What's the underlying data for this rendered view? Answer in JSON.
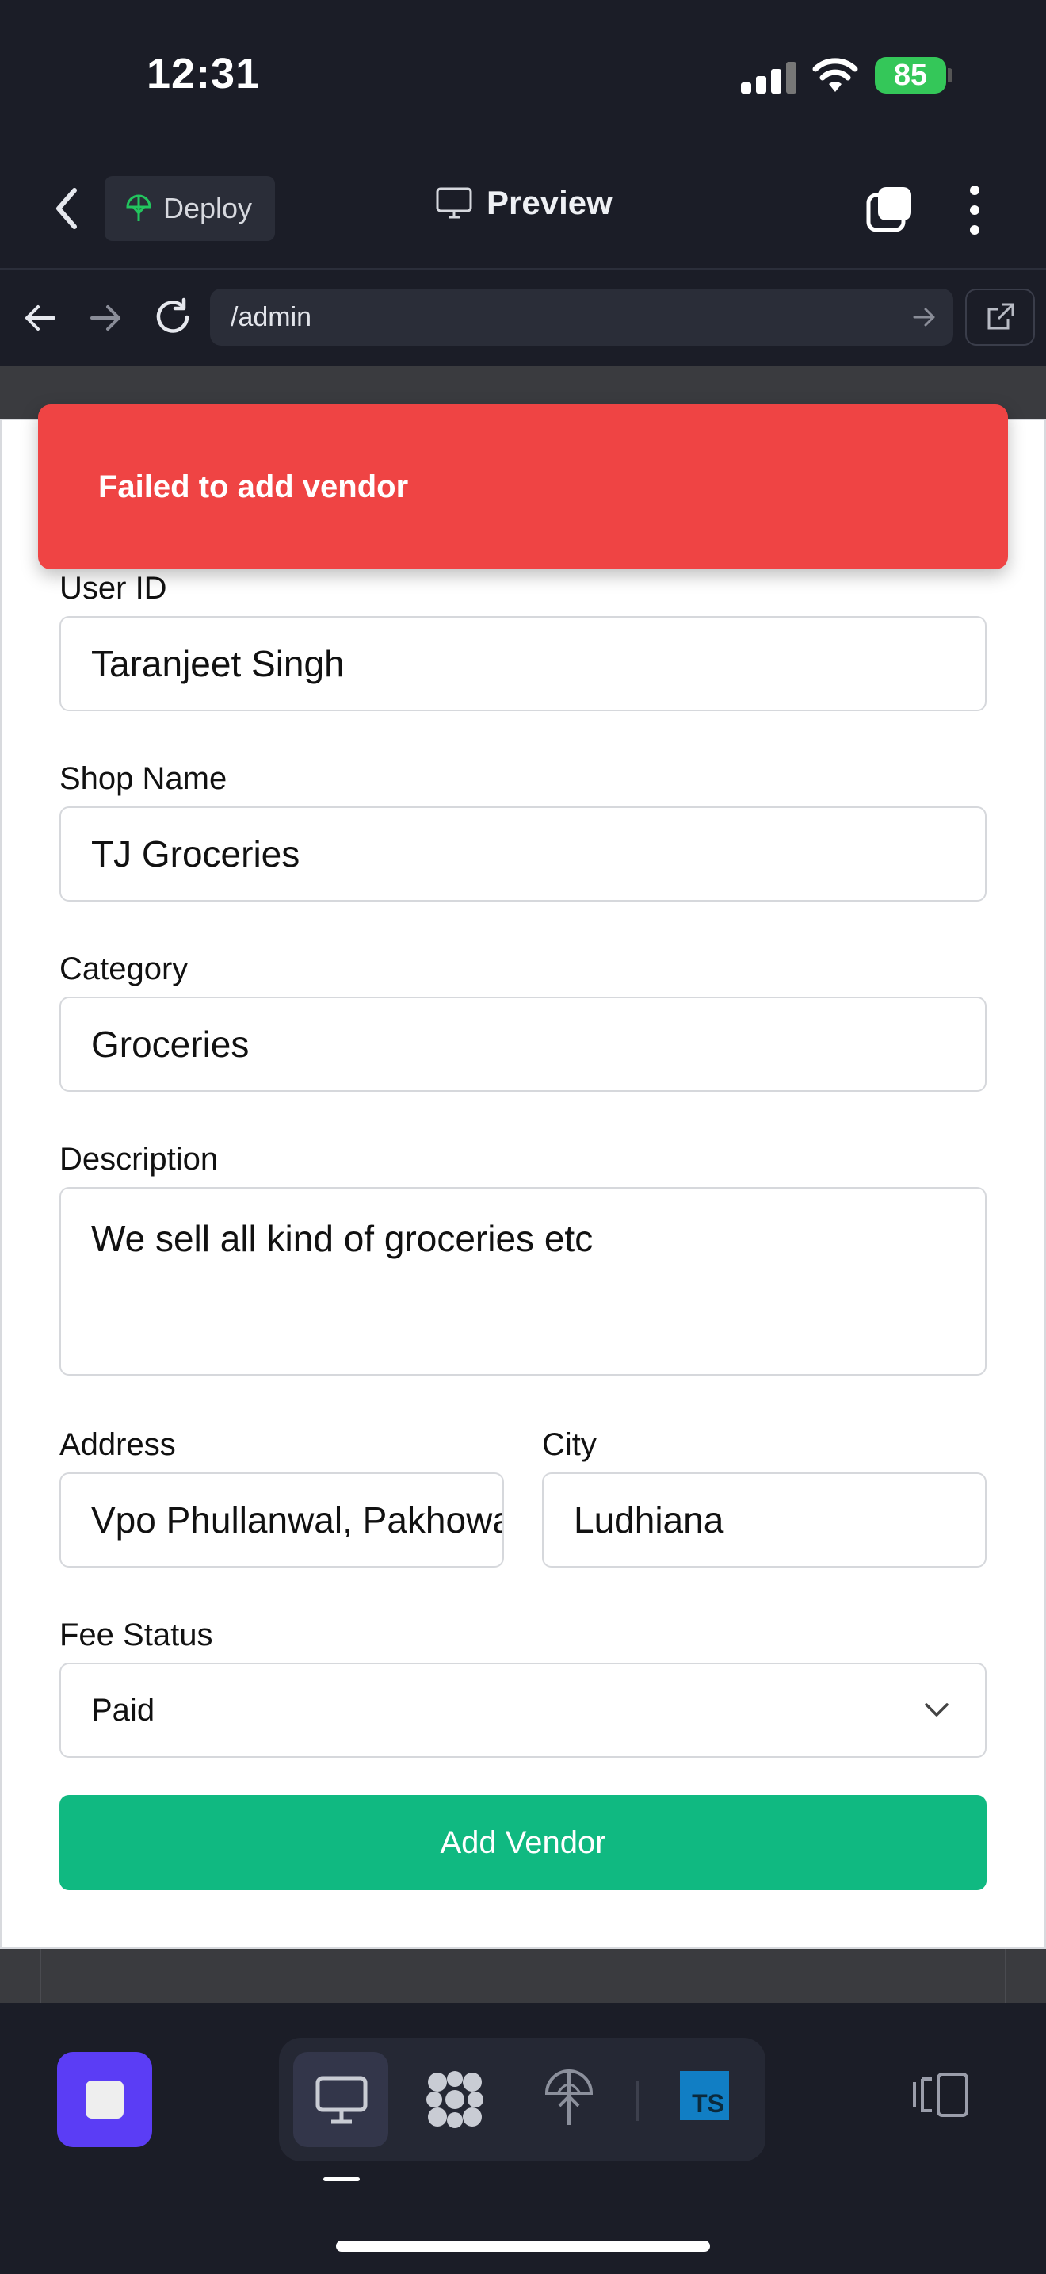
{
  "status_bar": {
    "time": "12:31",
    "battery": "85"
  },
  "app_bar": {
    "deploy_label": "Deploy",
    "preview_label": "Preview"
  },
  "browser": {
    "url": "/admin"
  },
  "toast": {
    "message": "Failed to add vendor"
  },
  "form": {
    "user_id": {
      "label": "User ID",
      "value": "Taranjeet Singh"
    },
    "shop_name": {
      "label": "Shop Name",
      "value": "TJ Groceries"
    },
    "category": {
      "label": "Category",
      "value": "Groceries"
    },
    "description": {
      "label": "Description",
      "value": "We sell all kind of groceries etc"
    },
    "address": {
      "label": "Address",
      "value": "Vpo Phullanwal, Pakhowal"
    },
    "city": {
      "label": "City",
      "value": "Ludhiana"
    },
    "fee_status": {
      "label": "Fee Status",
      "value": "Paid"
    },
    "submit_label": "Add Vendor"
  },
  "dock": {
    "ts_badge": "TS"
  },
  "colors": {
    "error": "#ef4444",
    "primary": "#10b981",
    "stop": "#5b3df5",
    "background": "#1b1d27"
  }
}
